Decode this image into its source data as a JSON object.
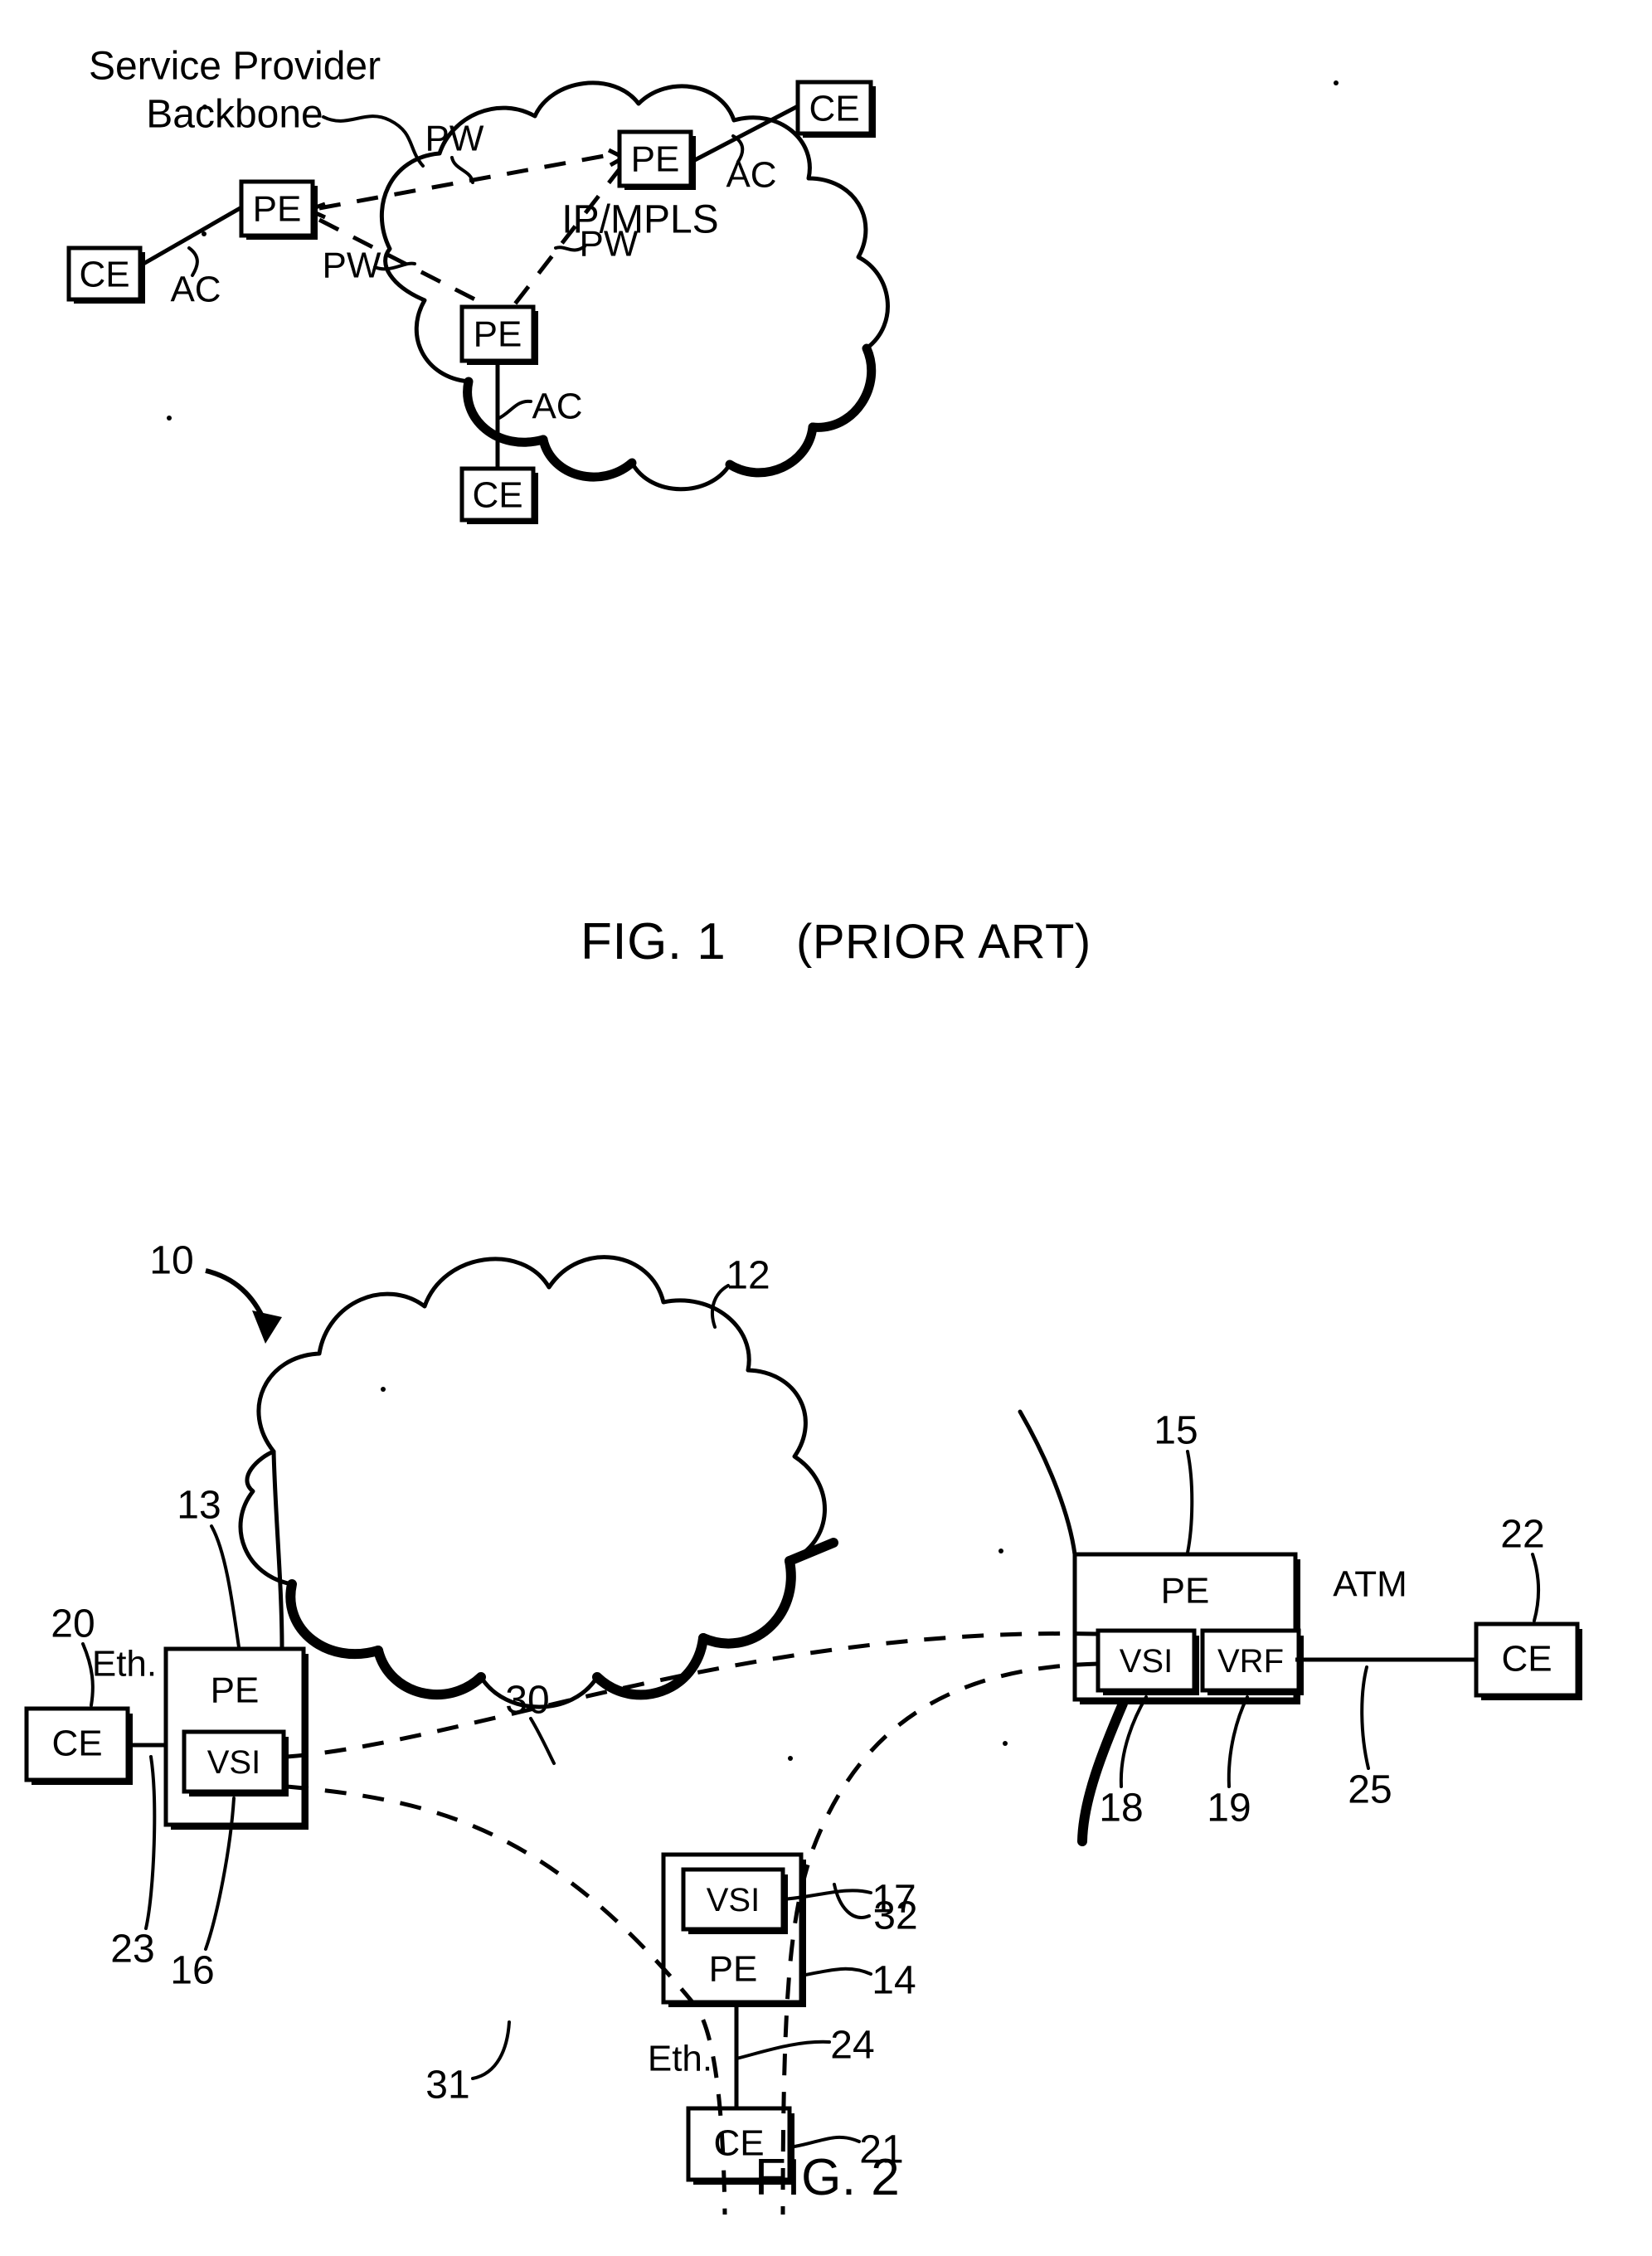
{
  "document": {
    "type": "patent-drawing-sheet",
    "figures": [
      "FIG. 1",
      "FIG. 2"
    ]
  },
  "fig1": {
    "caption": "FIG. 1",
    "caption_suffix": "(PRIOR ART)",
    "cloud_title": {
      "line1": "Service Provider",
      "line2": "Backbone"
    },
    "cloud_interior_label": "IP/MPLS",
    "nodes": [
      {
        "id": "pe-left",
        "label": "PE"
      },
      {
        "id": "pe-right",
        "label": "PE"
      },
      {
        "id": "pe-bottom",
        "label": "PE"
      },
      {
        "id": "ce-left",
        "label": "CE"
      },
      {
        "id": "ce-right",
        "label": "CE"
      },
      {
        "id": "ce-bottom",
        "label": "CE"
      }
    ],
    "pw_labels": [
      "PW",
      "PW",
      "PW"
    ],
    "ac_labels": [
      "AC",
      "AC",
      "AC"
    ]
  },
  "fig2": {
    "caption": "FIG. 2",
    "system_ref": "10",
    "cloud_ref": "12",
    "nodes": [
      {
        "id": "pe-left",
        "label": "PE",
        "ref": "13"
      },
      {
        "id": "pe-right",
        "label": "PE",
        "ref": "15"
      },
      {
        "id": "pe-bottom",
        "label": "PE",
        "ref": "14"
      },
      {
        "id": "ce-left",
        "label": "CE",
        "ref": "20"
      },
      {
        "id": "ce-right",
        "label": "CE",
        "ref": "22"
      },
      {
        "id": "ce-bottom",
        "label": "CE",
        "ref": "21"
      }
    ],
    "inner_modules": [
      {
        "id": "vsi-left",
        "label": "VSI",
        "ref": "16"
      },
      {
        "id": "vsi-right",
        "label": "VSI",
        "ref": "18"
      },
      {
        "id": "vrf-right",
        "label": "VRF",
        "ref": "19"
      },
      {
        "id": "vsi-bottom",
        "label": "VSI",
        "ref": "17"
      }
    ],
    "links": [
      {
        "id": "eth-left",
        "label": "Eth.",
        "ref": "23"
      },
      {
        "id": "eth-bottom",
        "label": "Eth.",
        "ref": "24"
      },
      {
        "id": "atm-right",
        "label": "ATM",
        "ref": "25"
      }
    ],
    "tunnels": [
      {
        "id": "tunnel-30",
        "ref": "30"
      },
      {
        "id": "tunnel-31",
        "ref": "31"
      },
      {
        "id": "tunnel-32",
        "ref": "32"
      }
    ]
  }
}
